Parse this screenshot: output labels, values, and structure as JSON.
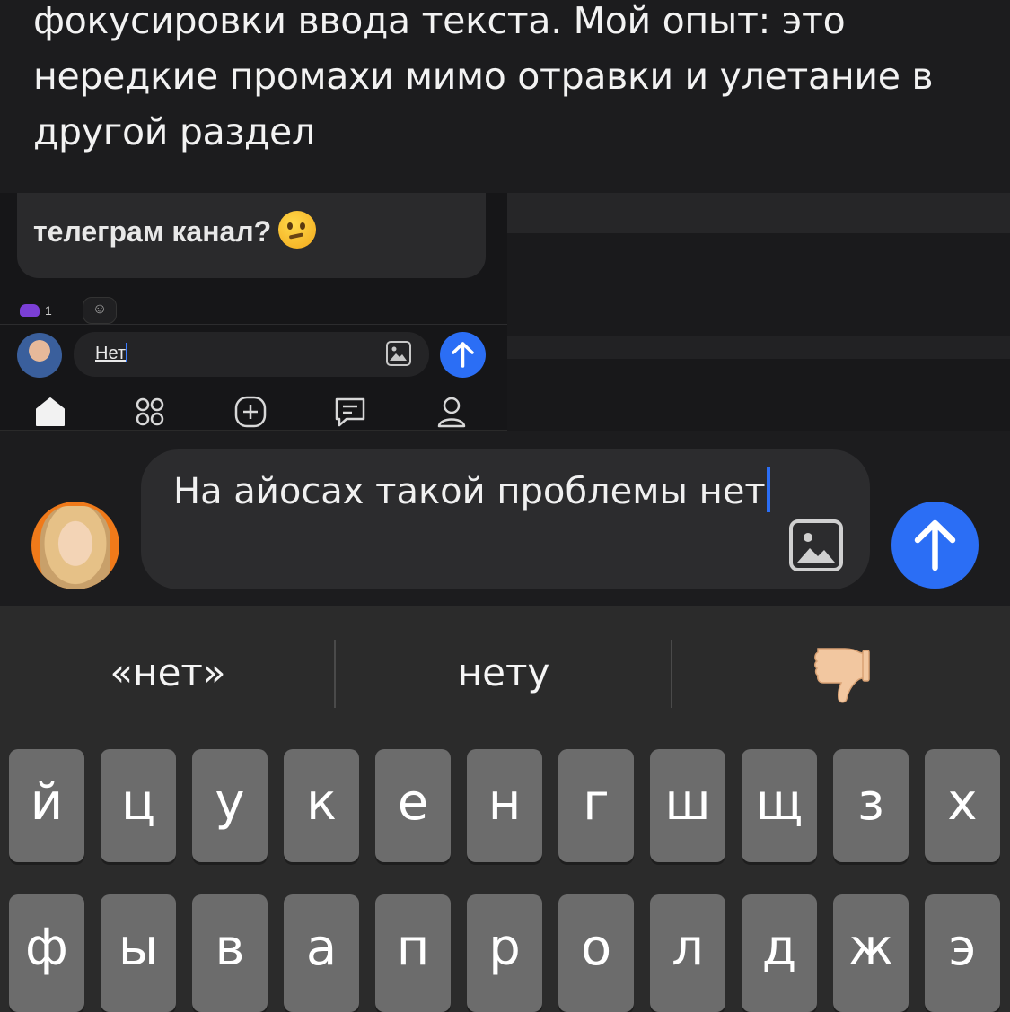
{
  "comment": {
    "text": "фокусировки ввода текста. Мой опыт: это нередкие промахи мимо отравки и улетание в другой раздел"
  },
  "embedded_screenshot": {
    "message_text": "телеграм канал?",
    "reaction_count": "1",
    "input_value": "Нет",
    "nav_items": [
      "home-icon",
      "apps-grid-icon",
      "add-icon",
      "messages-icon",
      "profile-icon"
    ]
  },
  "compose": {
    "input_value": "На айосах такой проблемы нет",
    "image_button_icon": "image-icon",
    "send_button_icon": "arrow-up-icon",
    "send_color": "#2b6ef5"
  },
  "keyboard": {
    "suggestions": [
      "«нет»",
      "нету"
    ],
    "suggestion_emoji_icon": "thumbs-down-icon",
    "row1": [
      "й",
      "ц",
      "у",
      "к",
      "е",
      "н",
      "г",
      "ш",
      "щ",
      "з",
      "х"
    ],
    "row2": [
      "ф",
      "ы",
      "в",
      "а",
      "п",
      "р",
      "о",
      "л",
      "д",
      "ж",
      "э"
    ]
  }
}
